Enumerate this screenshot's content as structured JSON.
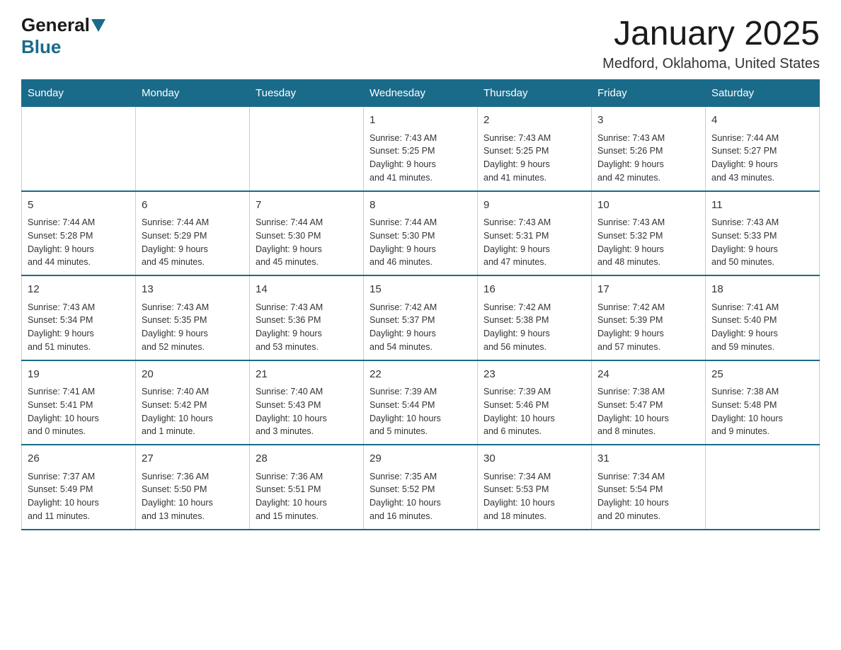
{
  "header": {
    "logo_text_general": "General",
    "logo_text_blue": "Blue",
    "title": "January 2025",
    "location": "Medford, Oklahoma, United States"
  },
  "calendar": {
    "days_of_week": [
      "Sunday",
      "Monday",
      "Tuesday",
      "Wednesday",
      "Thursday",
      "Friday",
      "Saturday"
    ],
    "weeks": [
      [
        {
          "day": "",
          "info": ""
        },
        {
          "day": "",
          "info": ""
        },
        {
          "day": "",
          "info": ""
        },
        {
          "day": "1",
          "info": "Sunrise: 7:43 AM\nSunset: 5:25 PM\nDaylight: 9 hours\nand 41 minutes."
        },
        {
          "day": "2",
          "info": "Sunrise: 7:43 AM\nSunset: 5:25 PM\nDaylight: 9 hours\nand 41 minutes."
        },
        {
          "day": "3",
          "info": "Sunrise: 7:43 AM\nSunset: 5:26 PM\nDaylight: 9 hours\nand 42 minutes."
        },
        {
          "day": "4",
          "info": "Sunrise: 7:44 AM\nSunset: 5:27 PM\nDaylight: 9 hours\nand 43 minutes."
        }
      ],
      [
        {
          "day": "5",
          "info": "Sunrise: 7:44 AM\nSunset: 5:28 PM\nDaylight: 9 hours\nand 44 minutes."
        },
        {
          "day": "6",
          "info": "Sunrise: 7:44 AM\nSunset: 5:29 PM\nDaylight: 9 hours\nand 45 minutes."
        },
        {
          "day": "7",
          "info": "Sunrise: 7:44 AM\nSunset: 5:30 PM\nDaylight: 9 hours\nand 45 minutes."
        },
        {
          "day": "8",
          "info": "Sunrise: 7:44 AM\nSunset: 5:30 PM\nDaylight: 9 hours\nand 46 minutes."
        },
        {
          "day": "9",
          "info": "Sunrise: 7:43 AM\nSunset: 5:31 PM\nDaylight: 9 hours\nand 47 minutes."
        },
        {
          "day": "10",
          "info": "Sunrise: 7:43 AM\nSunset: 5:32 PM\nDaylight: 9 hours\nand 48 minutes."
        },
        {
          "day": "11",
          "info": "Sunrise: 7:43 AM\nSunset: 5:33 PM\nDaylight: 9 hours\nand 50 minutes."
        }
      ],
      [
        {
          "day": "12",
          "info": "Sunrise: 7:43 AM\nSunset: 5:34 PM\nDaylight: 9 hours\nand 51 minutes."
        },
        {
          "day": "13",
          "info": "Sunrise: 7:43 AM\nSunset: 5:35 PM\nDaylight: 9 hours\nand 52 minutes."
        },
        {
          "day": "14",
          "info": "Sunrise: 7:43 AM\nSunset: 5:36 PM\nDaylight: 9 hours\nand 53 minutes."
        },
        {
          "day": "15",
          "info": "Sunrise: 7:42 AM\nSunset: 5:37 PM\nDaylight: 9 hours\nand 54 minutes."
        },
        {
          "day": "16",
          "info": "Sunrise: 7:42 AM\nSunset: 5:38 PM\nDaylight: 9 hours\nand 56 minutes."
        },
        {
          "day": "17",
          "info": "Sunrise: 7:42 AM\nSunset: 5:39 PM\nDaylight: 9 hours\nand 57 minutes."
        },
        {
          "day": "18",
          "info": "Sunrise: 7:41 AM\nSunset: 5:40 PM\nDaylight: 9 hours\nand 59 minutes."
        }
      ],
      [
        {
          "day": "19",
          "info": "Sunrise: 7:41 AM\nSunset: 5:41 PM\nDaylight: 10 hours\nand 0 minutes."
        },
        {
          "day": "20",
          "info": "Sunrise: 7:40 AM\nSunset: 5:42 PM\nDaylight: 10 hours\nand 1 minute."
        },
        {
          "day": "21",
          "info": "Sunrise: 7:40 AM\nSunset: 5:43 PM\nDaylight: 10 hours\nand 3 minutes."
        },
        {
          "day": "22",
          "info": "Sunrise: 7:39 AM\nSunset: 5:44 PM\nDaylight: 10 hours\nand 5 minutes."
        },
        {
          "day": "23",
          "info": "Sunrise: 7:39 AM\nSunset: 5:46 PM\nDaylight: 10 hours\nand 6 minutes."
        },
        {
          "day": "24",
          "info": "Sunrise: 7:38 AM\nSunset: 5:47 PM\nDaylight: 10 hours\nand 8 minutes."
        },
        {
          "day": "25",
          "info": "Sunrise: 7:38 AM\nSunset: 5:48 PM\nDaylight: 10 hours\nand 9 minutes."
        }
      ],
      [
        {
          "day": "26",
          "info": "Sunrise: 7:37 AM\nSunset: 5:49 PM\nDaylight: 10 hours\nand 11 minutes."
        },
        {
          "day": "27",
          "info": "Sunrise: 7:36 AM\nSunset: 5:50 PM\nDaylight: 10 hours\nand 13 minutes."
        },
        {
          "day": "28",
          "info": "Sunrise: 7:36 AM\nSunset: 5:51 PM\nDaylight: 10 hours\nand 15 minutes."
        },
        {
          "day": "29",
          "info": "Sunrise: 7:35 AM\nSunset: 5:52 PM\nDaylight: 10 hours\nand 16 minutes."
        },
        {
          "day": "30",
          "info": "Sunrise: 7:34 AM\nSunset: 5:53 PM\nDaylight: 10 hours\nand 18 minutes."
        },
        {
          "day": "31",
          "info": "Sunrise: 7:34 AM\nSunset: 5:54 PM\nDaylight: 10 hours\nand 20 minutes."
        },
        {
          "day": "",
          "info": ""
        }
      ]
    ]
  }
}
